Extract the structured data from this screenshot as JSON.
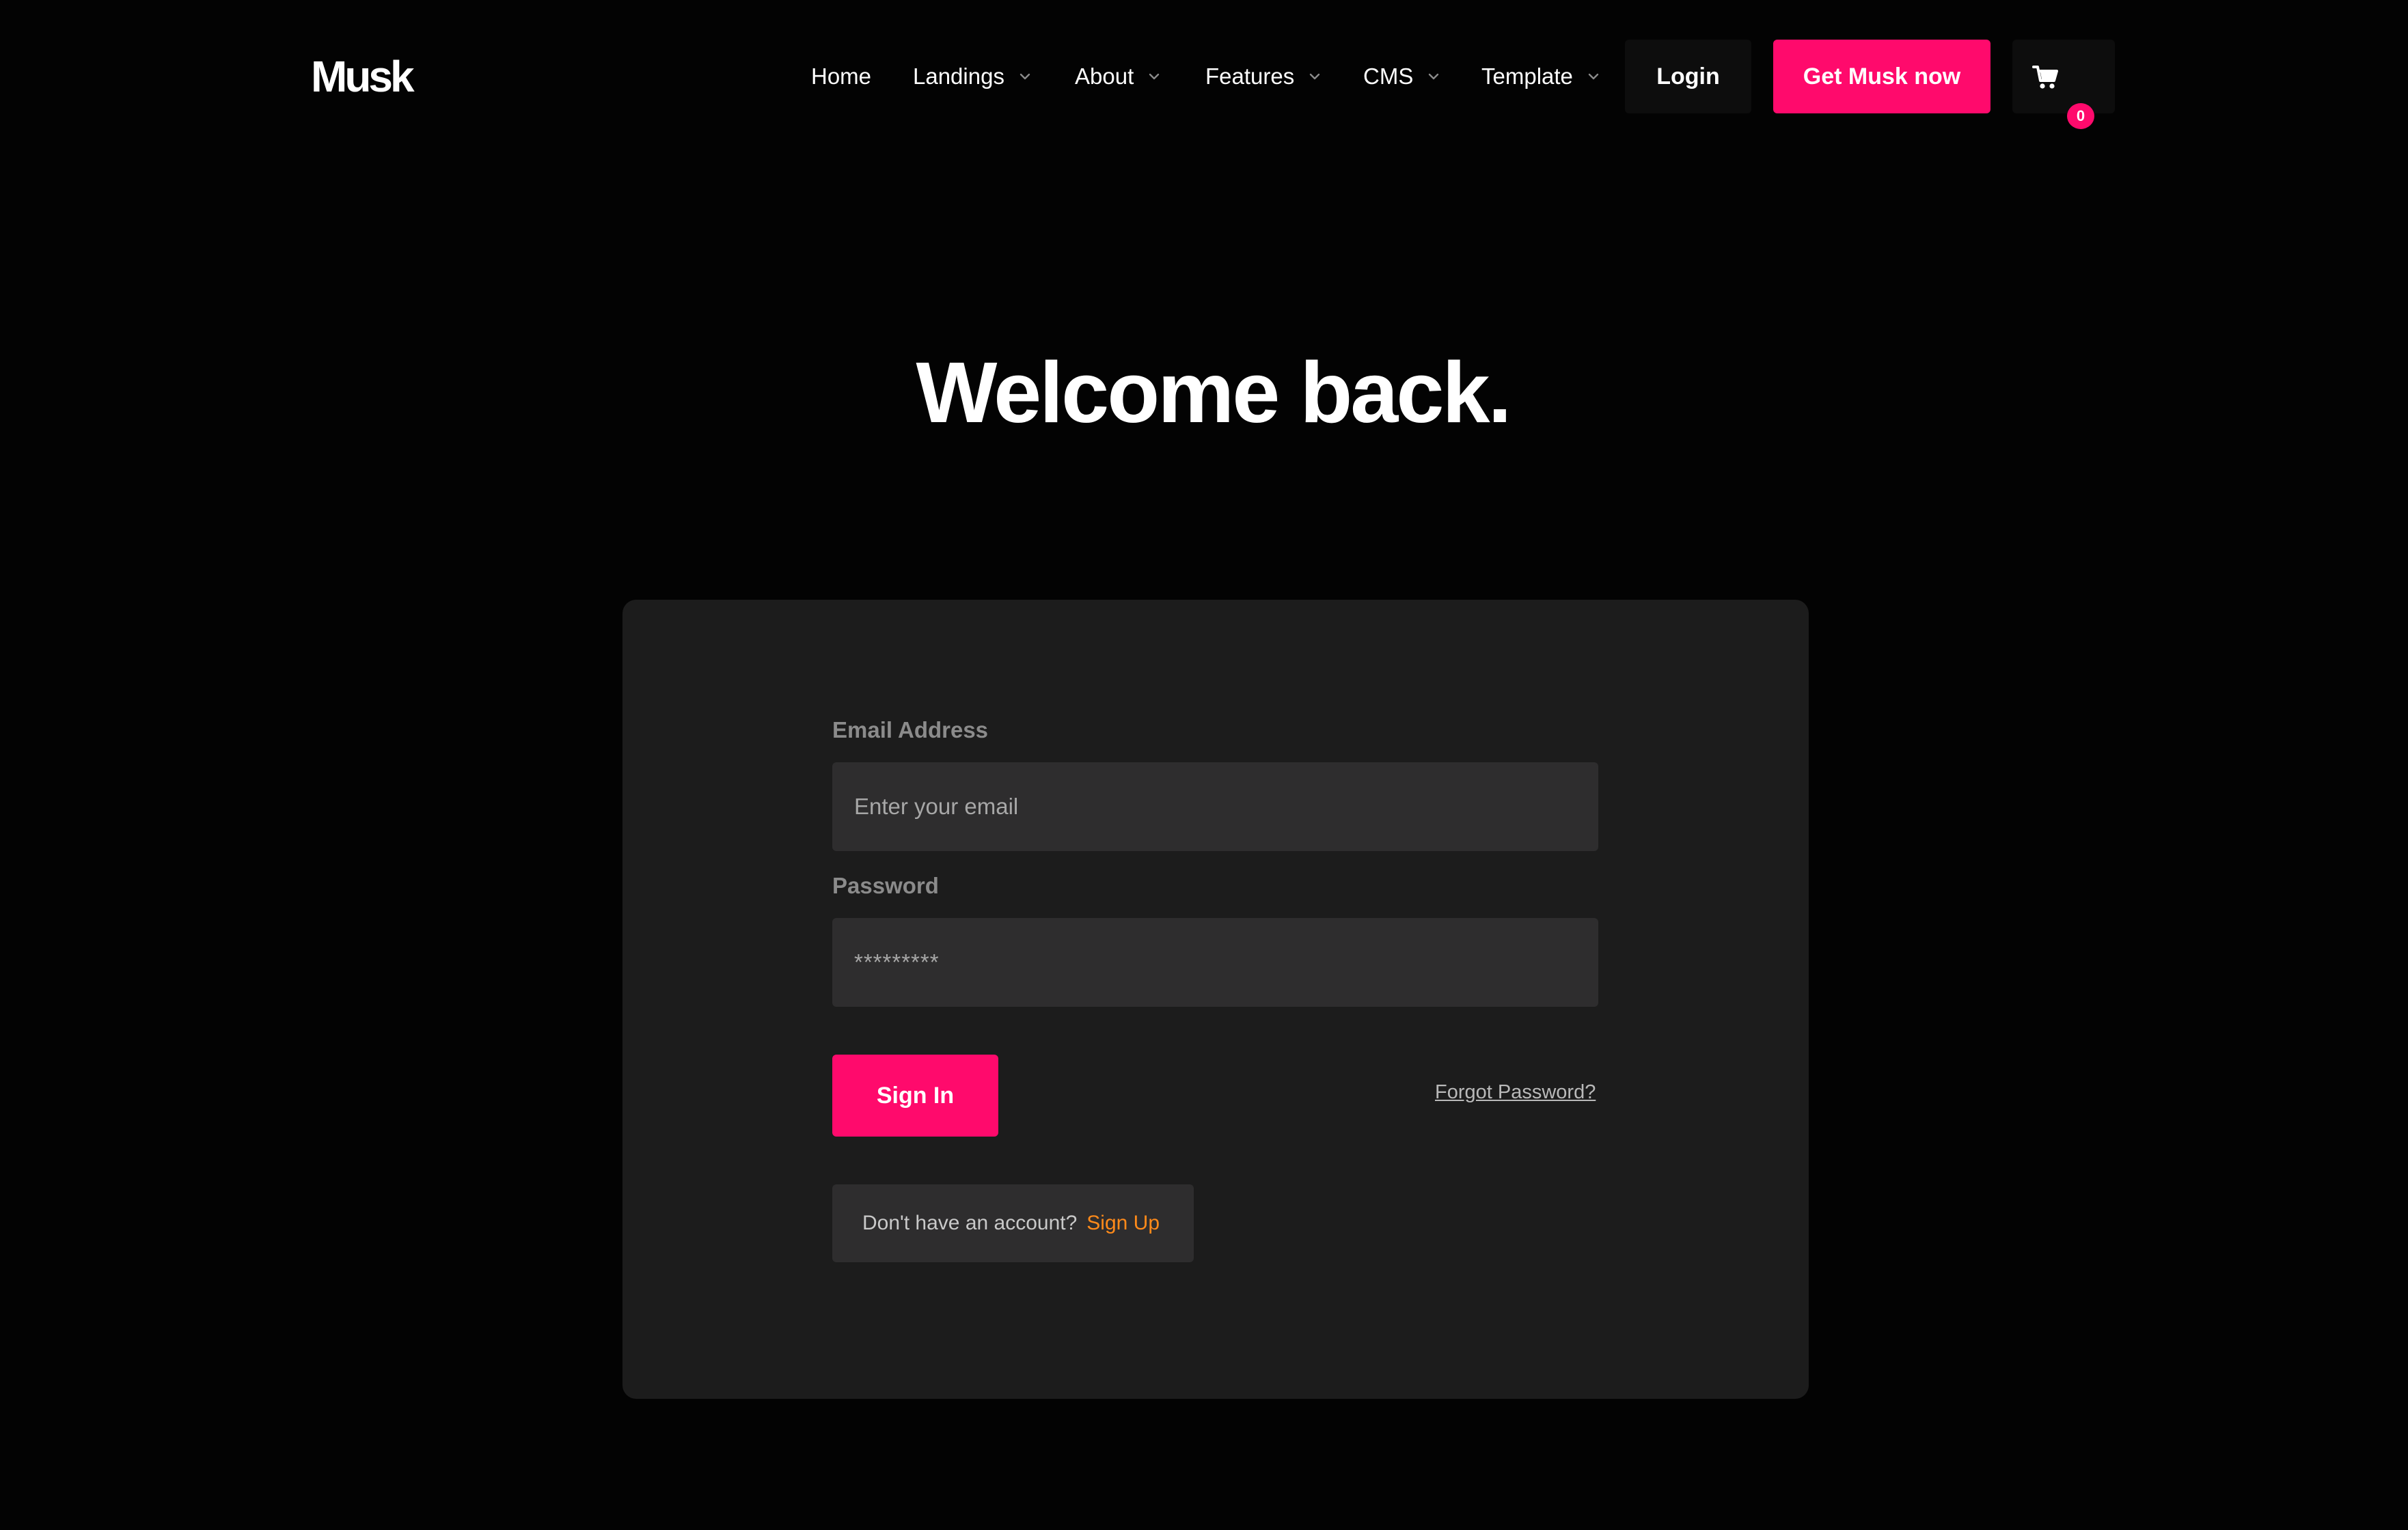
{
  "brand": {
    "logo": "Musk"
  },
  "nav": {
    "items": [
      {
        "label": "Home",
        "dropdown": false
      },
      {
        "label": "Landings",
        "dropdown": true
      },
      {
        "label": "About",
        "dropdown": true
      },
      {
        "label": "Features",
        "dropdown": true
      },
      {
        "label": "CMS",
        "dropdown": true
      },
      {
        "label": "Template",
        "dropdown": true
      }
    ],
    "login_label": "Login",
    "cta_label": "Get Musk now",
    "cart_count": "0"
  },
  "hero": {
    "title": "Welcome back."
  },
  "form": {
    "email_label": "Email Address",
    "email_placeholder": "Enter your email",
    "password_label": "Password",
    "password_value": "*********",
    "signin_label": "Sign In",
    "forgot_label": "Forgot Password?",
    "no_account_text": "Don't have an account?",
    "signup_label": "Sign Up"
  },
  "colors": {
    "background": "#030303",
    "accent": "#ff0a6c",
    "card": "#1c1c1c",
    "input": "#2e2d2e",
    "link_orange": "#ff8a1a"
  },
  "icons": {
    "cart": "cart-icon",
    "chevron": "chevron-down-icon"
  }
}
